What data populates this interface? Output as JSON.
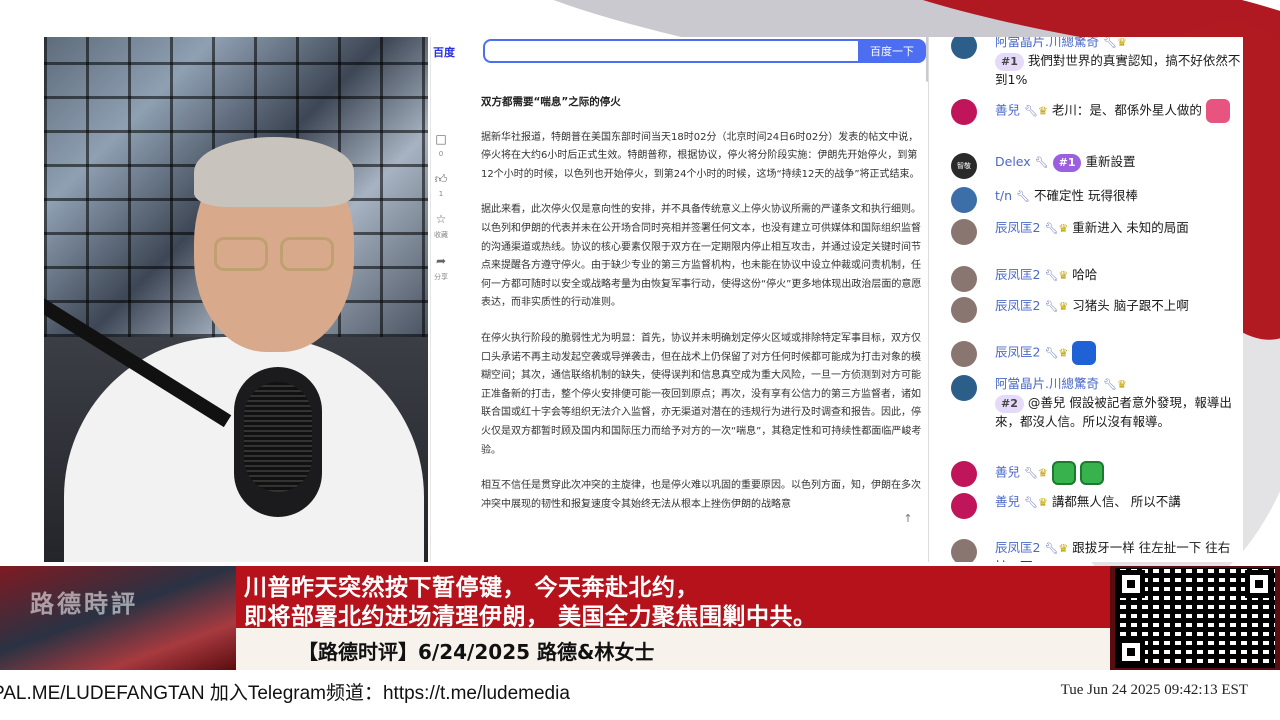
{
  "baidu": {
    "logo": "百度",
    "search_button": "百度一下"
  },
  "article_tools": [
    {
      "icon": "comment-icon",
      "count": "0"
    },
    {
      "icon": "like-icon",
      "count": "1"
    },
    {
      "icon": "star-icon",
      "count": "收藏"
    },
    {
      "icon": "share-icon",
      "count": "分享"
    }
  ],
  "article": {
    "heading": "双方都需要“喘息”之际的停火",
    "paragraphs": [
      "据新华社报道，特朗普在美国东部时间当天18时02分（北京时间24日6时02分）发表的帖文中说，停火将在大约6小时后正式生效。特朗普称，根据协议，停火将分阶段实施：伊朗先开始停火，到第12个小时的时候，以色列也开始停火，到第24个小时的时候，这场“持续12天的战争”将正式结束。",
      "据此来看，此次停火仅是意向性的安排，并不具备传统意义上停火协议所需的严谨条文和执行细则。以色列和伊朗的代表并未在公开场合同时亮相并签署任何文本，也没有建立可供媒体和国际组织监督的沟通渠道或热线。协议的核心要素仅限于双方在一定期限内停止相互攻击，并通过设定关键时间节点来提醒各方遵守停火。由于缺少专业的第三方监督机构，也未能在协议中设立仲裁或问责机制，任何一方都可随时以安全或战略考量为由恢复军事行动，使得这份“停火”更多地体现出政治层面的意愿表达，而非实质性的行动准则。",
      "在停火执行阶段的脆弱性尤为明显：首先，协议并未明确划定停火区域或排除特定军事目标，双方仅口头承诺不再主动发起空袭或导弹袭击，但在战术上仍保留了对方任何时候都可能成为打击对象的模糊空间；其次，通信联络机制的缺失，使得误判和信息真空成为重大风险，一旦一方侦测到对方可能正准备新的打击，整个停火安排便可能一夜回到原点；再次，没有享有公信力的第三方监督者，诸如联合国或红十字会等组织无法介入监督，亦无渠道对潜在的违规行为进行及时调查和报告。因此，停火仅是双方都暂时顾及国内和国际压力而给予对方的一次“喘息”，其稳定性和可持续性都面临严峻考验。",
      "相互不信任是贯穿此次冲突的主旋律，也是停火难以巩固的重要原因。以色列方面，知，伊朗在多次冲突中展现的韧性和报复速度令其始终无法从根本上挫伤伊朗的战略意"
    ]
  },
  "chat": [
    {
      "user": "阿當晶片.川總驚奇",
      "rank": "#1",
      "text": "我們對世界的真實認知，搞不好依然不到1%",
      "avatar": "teal"
    },
    {
      "user": "善兒",
      "text": "老川：是、都係外星人做的",
      "avatar": "pink",
      "emote": "pink"
    },
    {
      "user": "Delex",
      "rank": "#1",
      "text": "重新設置",
      "avatar": "dark",
      "avatar_text": "智敬"
    },
    {
      "user": "t/n",
      "text": "不確定性 玩得很棒",
      "avatar": "blue"
    },
    {
      "user": "辰凤匡2",
      "text": "重新进入 未知的局面",
      "avatar": "gray"
    },
    {
      "user": "辰凤匡2",
      "text": "哈哈",
      "avatar": "gray"
    },
    {
      "user": "辰凤匡2",
      "text": "习猪头 脑子跟不上啊",
      "avatar": "gray"
    },
    {
      "user": "辰凤匡2",
      "text": "",
      "avatar": "gray",
      "emote": "blue"
    },
    {
      "user": "阿當晶片.川總驚奇",
      "rank": "#2",
      "text": "@善兒 假設被記者意外發現，報導出來，都沒人信。所以沒有報導。",
      "avatar": "teal"
    },
    {
      "user": "善兒",
      "text": "",
      "avatar": "pink",
      "emote": "green2"
    },
    {
      "user": "善兒",
      "text": "講都無人信、 所以不講",
      "avatar": "pink"
    },
    {
      "user": "辰凤匡2",
      "text": "跟拔牙一样 往左扯一下 往右扯一下",
      "avatar": "gray"
    }
  ],
  "banner": {
    "logo": "路德時評",
    "headline_line1": "川普昨天突然按下暂停键， 今天奔赴北约，",
    "headline_line2": "即将部署北约进场清理伊朗， 美国全力聚焦围剿中共。",
    "subtitle": "【路德时评】6/24/2025 路德&林女士"
  },
  "ticker": {
    "text": "PAL.ME/LUDEFANGTAN  加入Telegram频道：https://t.me/ludemedia",
    "clock": "Tue Jun 24 2025 09:42:13 EST"
  },
  "colors": {
    "baidu_blue": "#4e6ef2",
    "banner_red": "#b5121b",
    "rank_purple": "#9b5fe0",
    "username_blue": "#4b68c8"
  }
}
